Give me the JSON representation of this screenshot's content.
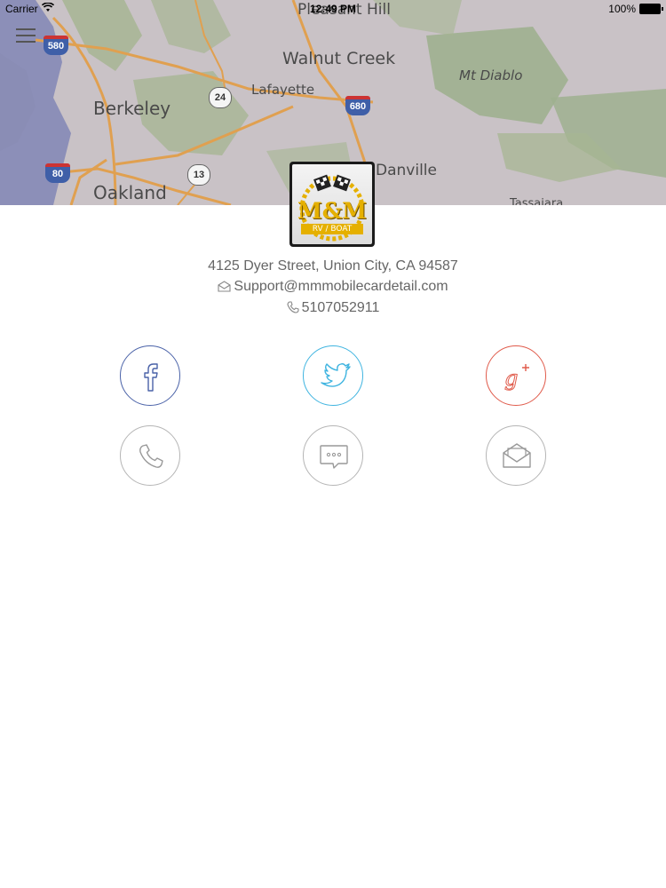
{
  "status_bar": {
    "carrier": "Carrier",
    "time": "12:49 PM",
    "battery": "100%"
  },
  "map": {
    "labels": {
      "pleasant_hill": "Pleasant Hill",
      "walnut_creek": "Walnut Creek",
      "berkeley": "Berkeley",
      "lafayette": "Lafayette",
      "mt_diablo": "Mt Diablo",
      "oakland": "Oakland",
      "danville": "Danville",
      "tassajara": "Tassajara"
    },
    "shields": {
      "i580": "580",
      "i680": "680",
      "i80": "80",
      "ca24": "24",
      "ca13": "13"
    },
    "colors": {
      "water": "#8c8fb8",
      "land": "#c9c2c6",
      "green": "#9fb08f",
      "road": "#e0a050"
    }
  },
  "logo": {
    "text": "M&M",
    "subtext": "RV / BOAT"
  },
  "contact": {
    "address": "4125 Dyer Street, Union City, CA 94587",
    "email": "Support@mmmobilecardetail.com",
    "phone": "5107052911"
  },
  "buttons": {
    "facebook": {
      "icon": "facebook-icon",
      "color": "#4a62a8"
    },
    "twitter": {
      "icon": "twitter-icon",
      "color": "#3fb4e0"
    },
    "google_plus": {
      "icon": "google-plus-icon",
      "color": "#e05a4a"
    },
    "call": {
      "icon": "phone-icon",
      "color": "#b5b5b5"
    },
    "sms": {
      "icon": "chat-bubble-icon",
      "color": "#b5b5b5"
    },
    "mail": {
      "icon": "envelope-icon",
      "color": "#b5b5b5"
    }
  }
}
